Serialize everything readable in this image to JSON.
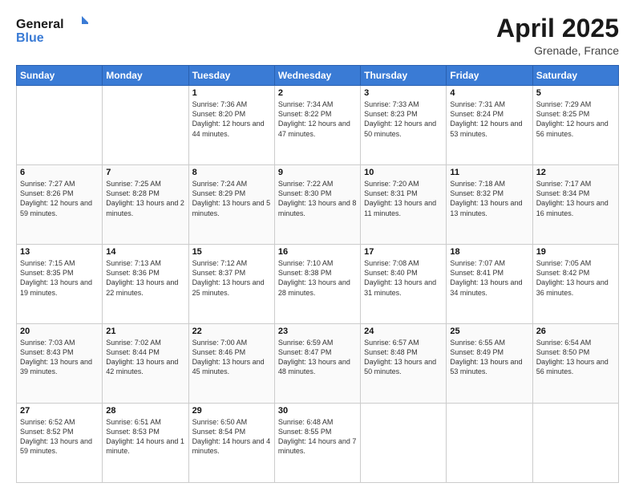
{
  "header": {
    "logo_line1": "General",
    "logo_line2": "Blue",
    "month": "April 2025",
    "location": "Grenade, France"
  },
  "days_of_week": [
    "Sunday",
    "Monday",
    "Tuesday",
    "Wednesday",
    "Thursday",
    "Friday",
    "Saturday"
  ],
  "weeks": [
    [
      {
        "num": "",
        "sunrise": "",
        "sunset": "",
        "daylight": ""
      },
      {
        "num": "",
        "sunrise": "",
        "sunset": "",
        "daylight": ""
      },
      {
        "num": "1",
        "sunrise": "Sunrise: 7:36 AM",
        "sunset": "Sunset: 8:20 PM",
        "daylight": "Daylight: 12 hours and 44 minutes."
      },
      {
        "num": "2",
        "sunrise": "Sunrise: 7:34 AM",
        "sunset": "Sunset: 8:22 PM",
        "daylight": "Daylight: 12 hours and 47 minutes."
      },
      {
        "num": "3",
        "sunrise": "Sunrise: 7:33 AM",
        "sunset": "Sunset: 8:23 PM",
        "daylight": "Daylight: 12 hours and 50 minutes."
      },
      {
        "num": "4",
        "sunrise": "Sunrise: 7:31 AM",
        "sunset": "Sunset: 8:24 PM",
        "daylight": "Daylight: 12 hours and 53 minutes."
      },
      {
        "num": "5",
        "sunrise": "Sunrise: 7:29 AM",
        "sunset": "Sunset: 8:25 PM",
        "daylight": "Daylight: 12 hours and 56 minutes."
      }
    ],
    [
      {
        "num": "6",
        "sunrise": "Sunrise: 7:27 AM",
        "sunset": "Sunset: 8:26 PM",
        "daylight": "Daylight: 12 hours and 59 minutes."
      },
      {
        "num": "7",
        "sunrise": "Sunrise: 7:25 AM",
        "sunset": "Sunset: 8:28 PM",
        "daylight": "Daylight: 13 hours and 2 minutes."
      },
      {
        "num": "8",
        "sunrise": "Sunrise: 7:24 AM",
        "sunset": "Sunset: 8:29 PM",
        "daylight": "Daylight: 13 hours and 5 minutes."
      },
      {
        "num": "9",
        "sunrise": "Sunrise: 7:22 AM",
        "sunset": "Sunset: 8:30 PM",
        "daylight": "Daylight: 13 hours and 8 minutes."
      },
      {
        "num": "10",
        "sunrise": "Sunrise: 7:20 AM",
        "sunset": "Sunset: 8:31 PM",
        "daylight": "Daylight: 13 hours and 11 minutes."
      },
      {
        "num": "11",
        "sunrise": "Sunrise: 7:18 AM",
        "sunset": "Sunset: 8:32 PM",
        "daylight": "Daylight: 13 hours and 13 minutes."
      },
      {
        "num": "12",
        "sunrise": "Sunrise: 7:17 AM",
        "sunset": "Sunset: 8:34 PM",
        "daylight": "Daylight: 13 hours and 16 minutes."
      }
    ],
    [
      {
        "num": "13",
        "sunrise": "Sunrise: 7:15 AM",
        "sunset": "Sunset: 8:35 PM",
        "daylight": "Daylight: 13 hours and 19 minutes."
      },
      {
        "num": "14",
        "sunrise": "Sunrise: 7:13 AM",
        "sunset": "Sunset: 8:36 PM",
        "daylight": "Daylight: 13 hours and 22 minutes."
      },
      {
        "num": "15",
        "sunrise": "Sunrise: 7:12 AM",
        "sunset": "Sunset: 8:37 PM",
        "daylight": "Daylight: 13 hours and 25 minutes."
      },
      {
        "num": "16",
        "sunrise": "Sunrise: 7:10 AM",
        "sunset": "Sunset: 8:38 PM",
        "daylight": "Daylight: 13 hours and 28 minutes."
      },
      {
        "num": "17",
        "sunrise": "Sunrise: 7:08 AM",
        "sunset": "Sunset: 8:40 PM",
        "daylight": "Daylight: 13 hours and 31 minutes."
      },
      {
        "num": "18",
        "sunrise": "Sunrise: 7:07 AM",
        "sunset": "Sunset: 8:41 PM",
        "daylight": "Daylight: 13 hours and 34 minutes."
      },
      {
        "num": "19",
        "sunrise": "Sunrise: 7:05 AM",
        "sunset": "Sunset: 8:42 PM",
        "daylight": "Daylight: 13 hours and 36 minutes."
      }
    ],
    [
      {
        "num": "20",
        "sunrise": "Sunrise: 7:03 AM",
        "sunset": "Sunset: 8:43 PM",
        "daylight": "Daylight: 13 hours and 39 minutes."
      },
      {
        "num": "21",
        "sunrise": "Sunrise: 7:02 AM",
        "sunset": "Sunset: 8:44 PM",
        "daylight": "Daylight: 13 hours and 42 minutes."
      },
      {
        "num": "22",
        "sunrise": "Sunrise: 7:00 AM",
        "sunset": "Sunset: 8:46 PM",
        "daylight": "Daylight: 13 hours and 45 minutes."
      },
      {
        "num": "23",
        "sunrise": "Sunrise: 6:59 AM",
        "sunset": "Sunset: 8:47 PM",
        "daylight": "Daylight: 13 hours and 48 minutes."
      },
      {
        "num": "24",
        "sunrise": "Sunrise: 6:57 AM",
        "sunset": "Sunset: 8:48 PM",
        "daylight": "Daylight: 13 hours and 50 minutes."
      },
      {
        "num": "25",
        "sunrise": "Sunrise: 6:55 AM",
        "sunset": "Sunset: 8:49 PM",
        "daylight": "Daylight: 13 hours and 53 minutes."
      },
      {
        "num": "26",
        "sunrise": "Sunrise: 6:54 AM",
        "sunset": "Sunset: 8:50 PM",
        "daylight": "Daylight: 13 hours and 56 minutes."
      }
    ],
    [
      {
        "num": "27",
        "sunrise": "Sunrise: 6:52 AM",
        "sunset": "Sunset: 8:52 PM",
        "daylight": "Daylight: 13 hours and 59 minutes."
      },
      {
        "num": "28",
        "sunrise": "Sunrise: 6:51 AM",
        "sunset": "Sunset: 8:53 PM",
        "daylight": "Daylight: 14 hours and 1 minute."
      },
      {
        "num": "29",
        "sunrise": "Sunrise: 6:50 AM",
        "sunset": "Sunset: 8:54 PM",
        "daylight": "Daylight: 14 hours and 4 minutes."
      },
      {
        "num": "30",
        "sunrise": "Sunrise: 6:48 AM",
        "sunset": "Sunset: 8:55 PM",
        "daylight": "Daylight: 14 hours and 7 minutes."
      },
      {
        "num": "",
        "sunrise": "",
        "sunset": "",
        "daylight": ""
      },
      {
        "num": "",
        "sunrise": "",
        "sunset": "",
        "daylight": ""
      },
      {
        "num": "",
        "sunrise": "",
        "sunset": "",
        "daylight": ""
      }
    ]
  ]
}
